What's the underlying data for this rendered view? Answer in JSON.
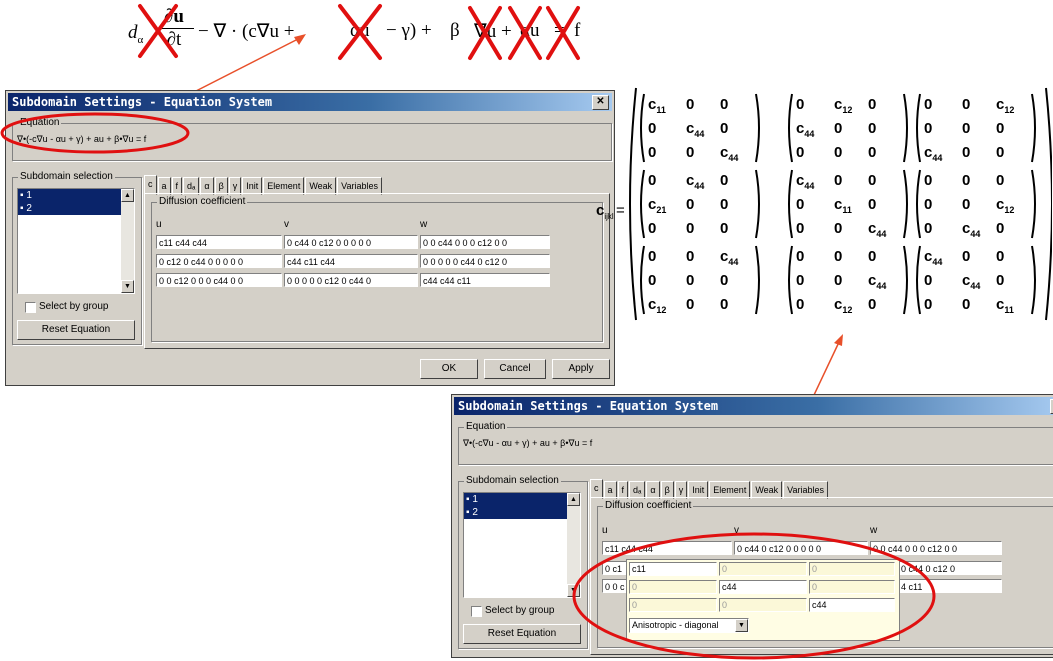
{
  "equation": {
    "lhs_a": "d",
    "lhs_a_sub": "α",
    "frac_num": "∂u",
    "frac_den": "∂t",
    "t1": "− ∇ · (c∇u +",
    "t2": "αu",
    "t3": "− γ) +",
    "t4": "β",
    "t5": "∇u +",
    "t6": "αu",
    "t7": "=",
    "t8": "f"
  },
  "dialog": {
    "title": "Subdomain Settings - Equation System",
    "close": "✕",
    "equation_label": "Equation",
    "equation_text": "∇•(-c∇u - αu + γ) + au + β•∇u = f",
    "subdomain_label": "Subdomain selection",
    "items": [
      "1",
      "2"
    ],
    "select_by_group": "Select by group",
    "reset": "Reset Equation",
    "tabs": [
      "c",
      "a",
      "f",
      "dₐ",
      "α",
      "β",
      "γ",
      "Init",
      "Element",
      "Weak",
      "Variables"
    ],
    "diffusion_label": "Diffusion coefficient",
    "col_u": "u",
    "col_v": "v",
    "col_w": "w",
    "grid": [
      [
        "c11 c44 c44",
        "0 c44 0 c12 0 0 0 0 0",
        "0 0 c44 0 0 0 c12 0 0"
      ],
      [
        "0 c12 0 c44 0 0 0 0 0",
        "c44 c11 c44",
        "0 0 0 0 0 c44 0 c12 0"
      ],
      [
        "0 0 c12 0 0 0 c44 0 0",
        "0 0 0 0 0 c12 0 c44 0",
        "c44 c44 c11"
      ]
    ],
    "ok": "OK",
    "cancel": "Cancel",
    "apply": "Apply"
  },
  "dialog2": {
    "row0": [
      "c11 c44 c44",
      "0 c44 0 c12 0 0 0 0 0",
      "0 0 c44 0 0 0 c12 0 0"
    ],
    "row1_left": "0 c1",
    "row1_right": "0 c44 0 c12 0",
    "row2_left": "0 0 c",
    "row2_right": "4 c11",
    "popup": [
      [
        "c11",
        "0",
        "0",
        "0"
      ],
      [
        "0",
        "c44",
        "0",
        "0"
      ],
      [
        "0",
        "0",
        "0",
        "c44"
      ]
    ],
    "mode": "Anisotropic - diagonal"
  },
  "matrix": {
    "lhs": "c",
    "lhs_sub": "ijkl",
    "eq": "=",
    "blocks": [
      [
        [
          "c11",
          "0",
          "0"
        ],
        [
          "0",
          "c44",
          "0"
        ],
        [
          "0",
          "0",
          "c44"
        ]
      ],
      [
        [
          "0",
          "c12",
          "0"
        ],
        [
          "c44",
          "0",
          "0"
        ],
        [
          "0",
          "0",
          "0"
        ]
      ],
      [
        [
          "0",
          "0",
          "c12"
        ],
        [
          "0",
          "0",
          "0"
        ],
        [
          "c44",
          "0",
          "0"
        ]
      ],
      [
        [
          "0",
          "c44",
          "0"
        ],
        [
          "c21",
          "0",
          "0"
        ],
        [
          "0",
          "0",
          "0"
        ]
      ],
      [
        [
          "c44",
          "0",
          "0"
        ],
        [
          "0",
          "c11",
          "0"
        ],
        [
          "0",
          "0",
          "c44"
        ]
      ],
      [
        [
          "0",
          "0",
          "0"
        ],
        [
          "0",
          "0",
          "c12"
        ],
        [
          "0",
          "c44",
          "0"
        ]
      ],
      [
        [
          "0",
          "0",
          "c44"
        ],
        [
          "0",
          "0",
          "0"
        ],
        [
          "c12",
          "0",
          "0"
        ]
      ],
      [
        [
          "0",
          "0",
          "0"
        ],
        [
          "0",
          "0",
          "c44"
        ],
        [
          "0",
          "c12",
          "0"
        ]
      ],
      [
        [
          "c44",
          "0",
          "0"
        ],
        [
          "0",
          "c44",
          "0"
        ],
        [
          "0",
          "0",
          "c11"
        ]
      ]
    ]
  }
}
